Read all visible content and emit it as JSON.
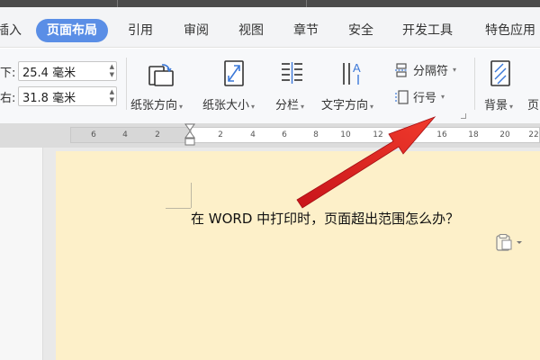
{
  "tabs": [
    {
      "label": "插入",
      "active": false
    },
    {
      "label": "页面布局",
      "active": true
    },
    {
      "label": "引用",
      "active": false
    },
    {
      "label": "审阅",
      "active": false
    },
    {
      "label": "视图",
      "active": false
    },
    {
      "label": "章节",
      "active": false
    },
    {
      "label": "安全",
      "active": false
    },
    {
      "label": "开发工具",
      "active": false
    },
    {
      "label": "特色应用",
      "active": false
    }
  ],
  "margins": {
    "bottom": {
      "label": "下:",
      "value": "25.4 毫米"
    },
    "right": {
      "label": "右:",
      "value": "31.8 毫米"
    }
  },
  "toolbar": {
    "orientation": "纸张方向",
    "size": "纸张大小",
    "columns": "分栏",
    "text_direction": "文字方向",
    "breaks": "分隔符",
    "line_numbers": "行号",
    "background": "背景",
    "cut_label": "页"
  },
  "ruler": {
    "ticks": [
      "6",
      "4",
      "2",
      "2",
      "4",
      "6",
      "8",
      "10",
      "12",
      "14",
      "16",
      "18",
      "20",
      "22"
    ]
  },
  "document": {
    "text": "在 WORD 中打印时，页面超出范围怎么办？"
  },
  "icons": {
    "orientation": "page-orientation-icon",
    "size": "page-size-icon",
    "columns": "columns-icon",
    "text_direction": "text-direction-icon",
    "breaks": "breaks-icon",
    "line_numbers": "line-numbers-icon",
    "background": "background-icon",
    "paste_options": "paste-options-icon"
  },
  "colors": {
    "active_tab": "#5a8ee6",
    "page_background": "#fdf0c9",
    "annotation_arrow": "#e8231f"
  }
}
